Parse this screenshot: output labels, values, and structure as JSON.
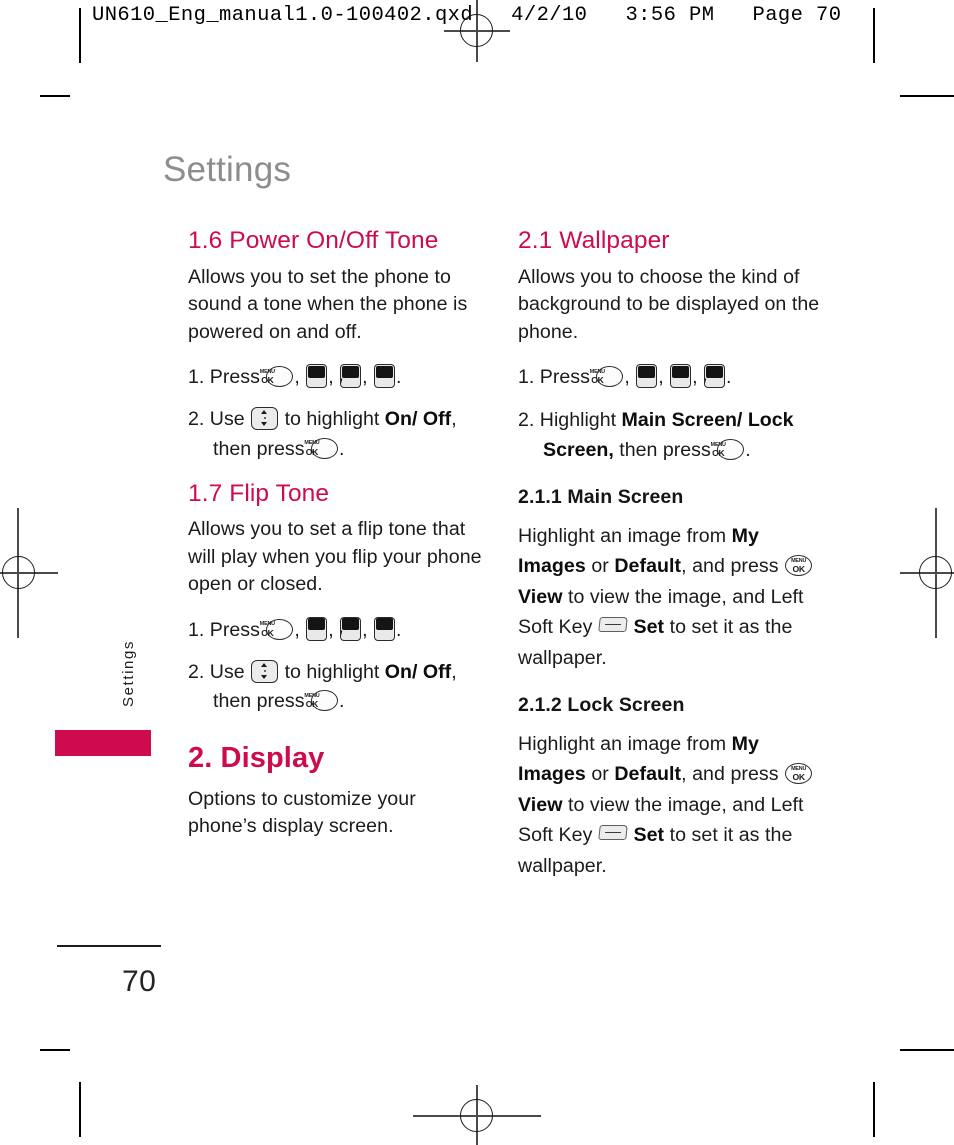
{
  "proof_header": "UN610_Eng_manual1.0-100402.qxd   4/2/10   3:56 PM   Page 70",
  "page": {
    "title": "Settings",
    "number": "70",
    "side_tab_label": "Settings",
    "accent_color": "#ce0b4e",
    "title_color": "#8d8d8d"
  },
  "left_column": {
    "sections": [
      {
        "heading": "1.6 Power On/Off Tone",
        "body": "Allows you to set the phone to sound a tone when the phone is powered on and off.",
        "steps": [
          {
            "number": "1.",
            "verb": "Press",
            "keys": [
              "menu-ok",
              "9-C",
              "1-W",
              "6-F"
            ],
            "trailing": "."
          },
          {
            "number": "2.",
            "verb": "Use",
            "nav_key": "nav-up-down",
            "text_a": "to highlight",
            "bold_a": "On/ Off",
            "text_b": ", then press",
            "end_key": "menu-ok",
            "trailing": "."
          }
        ]
      },
      {
        "heading": "1.7 Flip Tone",
        "body": "Allows you to set a flip tone that will play when you flip your phone open or closed.",
        "steps": [
          {
            "number": "1.",
            "verb": "Press",
            "keys": [
              "menu-ok",
              "9-C",
              "1-W",
              "7-Z"
            ],
            "trailing": "."
          },
          {
            "number": "2.",
            "verb": "Use",
            "nav_key": "nav-up-down",
            "text_a": "to highlight",
            "bold_a": "On/ Off",
            "text_b": ", then press",
            "end_key": "menu-ok",
            "trailing": "."
          }
        ]
      },
      {
        "heading": "2. Display",
        "body": "Options to customize your phone’s display screen."
      }
    ]
  },
  "right_column": {
    "sections": [
      {
        "heading": "2.1 Wallpaper",
        "body": "Allows you to choose the kind of background to be displayed on the phone.",
        "steps": [
          {
            "number": "1.",
            "verb": "Press",
            "keys": [
              "menu-ok",
              "9-C",
              "2-E",
              "1-W"
            ],
            "trailing": "."
          },
          {
            "number": "2.",
            "verb": "Highlight",
            "bold_a": "Main Screen/ Lock Screen,",
            "text_b": "then press",
            "end_key": "menu-ok",
            "trailing": "."
          }
        ]
      },
      {
        "subheading": "2.1.1 Main Screen",
        "paragraph": {
          "p1": "Highlight an image from",
          "b1": "My Images",
          "p2": "or",
          "b2": "Default",
          "p3": ", and press",
          "key1": "menu-ok",
          "b3": "View",
          "p4": "to view the image, and Left Soft Key",
          "key2": "left-soft-key",
          "b4": "Set",
          "p5": "to set it as the wallpaper."
        }
      },
      {
        "subheading": "2.1.2 Lock Screen",
        "paragraph": {
          "p1": "Highlight an image from",
          "b1": "My Images",
          "p2": "or",
          "b2": "Default",
          "p3": ", and press",
          "key1": "menu-ok",
          "b3": "View",
          "p4": "to view the image, and Left Soft Key",
          "key2": "left-soft-key",
          "b4": "Set",
          "p5": "to set it as the wallpaper."
        }
      }
    ]
  },
  "keys": {
    "menu_ok": {
      "line1": "MENU",
      "line2": "OK"
    },
    "k9": {
      "num": "9",
      "letter": "C"
    },
    "k1": {
      "num": "1",
      "letter": "W"
    },
    "k6": {
      "num": "6",
      "letter": "F"
    },
    "k7": {
      "num": "7",
      "letter": "Z"
    },
    "k2": {
      "num": "2",
      "letter": "E"
    }
  }
}
